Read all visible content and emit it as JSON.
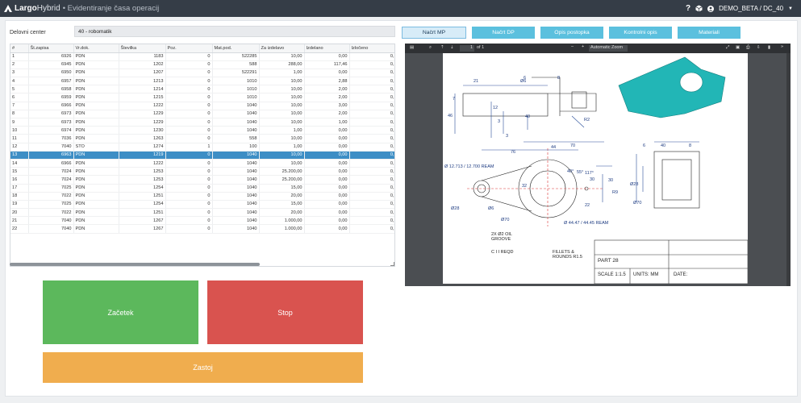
{
  "header": {
    "brand_bold": "Largo",
    "brand_light": "Hybrid",
    "subtitle": "• Evidentiranje časa operacij",
    "help_icon": "?",
    "user": "DEMO_BETA / DC_40"
  },
  "work_center": {
    "label": "Delovni center",
    "value": "40 - robomatik"
  },
  "grid": {
    "columns": [
      "#",
      "Št.zapisa",
      "Vr.dok.",
      "Številka",
      "Poz.",
      "Mat.pod.",
      "Za izdelavo",
      "Izdelano",
      "Izločeno"
    ],
    "rows": [
      [
        "1",
        "6926",
        "PDN",
        "1183",
        "0",
        "522285",
        "10,00",
        "0,00",
        "0,"
      ],
      [
        "2",
        "6945",
        "PDN",
        "1202",
        "0",
        "588",
        "288,00",
        "117,46",
        "0,"
      ],
      [
        "3",
        "6950",
        "PDN",
        "1207",
        "0",
        "522291",
        "1,00",
        "0,00",
        "0,"
      ],
      [
        "4",
        "6957",
        "PDN",
        "1213",
        "0",
        "1010",
        "10,00",
        "2,88",
        "0,"
      ],
      [
        "5",
        "6958",
        "PDN",
        "1214",
        "0",
        "1010",
        "10,00",
        "2,00",
        "0,"
      ],
      [
        "6",
        "6959",
        "PDN",
        "1215",
        "0",
        "1010",
        "10,00",
        "2,00",
        "0,"
      ],
      [
        "7",
        "6966",
        "PDN",
        "1222",
        "0",
        "1040",
        "10,00",
        "3,00",
        "0,"
      ],
      [
        "8",
        "6973",
        "PDN",
        "1229",
        "0",
        "1040",
        "10,00",
        "2,00",
        "0,"
      ],
      [
        "9",
        "6973",
        "PDN",
        "1229",
        "0",
        "1040",
        "10,00",
        "1,00",
        "0,"
      ],
      [
        "10",
        "6974",
        "PDN",
        "1230",
        "0",
        "1040",
        "1,00",
        "0,00",
        "0,"
      ],
      [
        "11",
        "7036",
        "PDN",
        "1263",
        "0",
        "558",
        "10,00",
        "0,00",
        "0,"
      ],
      [
        "12",
        "7040",
        "STO",
        "1274",
        "1",
        "100",
        "1,00",
        "0,00",
        "0,"
      ],
      [
        "13",
        "6963",
        "PDN",
        "1219",
        "0",
        "1040",
        "10,00",
        "0,00",
        "0,"
      ],
      [
        "14",
        "6966",
        "PDN",
        "1222",
        "0",
        "1040",
        "10,00",
        "0,00",
        "0,"
      ],
      [
        "15",
        "7024",
        "PDN",
        "1253",
        "0",
        "1040",
        "25.200,00",
        "0,00",
        "0,"
      ],
      [
        "16",
        "7024",
        "PDN",
        "1253",
        "0",
        "1040",
        "25.200,00",
        "0,00",
        "0,"
      ],
      [
        "17",
        "7025",
        "PDN",
        "1254",
        "0",
        "1040",
        "15,00",
        "0,00",
        "0,"
      ],
      [
        "18",
        "7022",
        "PDN",
        "1251",
        "0",
        "1040",
        "20,00",
        "0,00",
        "0,"
      ],
      [
        "19",
        "7025",
        "PDN",
        "1254",
        "0",
        "1040",
        "15,00",
        "0,00",
        "0,"
      ],
      [
        "20",
        "7022",
        "PDN",
        "1251",
        "0",
        "1040",
        "20,00",
        "0,00",
        "0,"
      ],
      [
        "21",
        "7040",
        "PDN",
        "1267",
        "0",
        "1040",
        "1.000,00",
        "0,00",
        "0,"
      ],
      [
        "22",
        "7040",
        "PDN",
        "1267",
        "0",
        "1040",
        "1.000,00",
        "0,00",
        "0,"
      ]
    ],
    "selected_row": 12
  },
  "actions": {
    "start": "Začetek",
    "stop": "Stop",
    "downtime": "Zastoj"
  },
  "tabs": [
    "Načrt MP",
    "Načrt DP",
    "Opis postopka",
    "Kontrolni opis",
    "Materiali"
  ],
  "viewer": {
    "page_current": "1",
    "page_total": "of 1",
    "zoom": "Automatic Zoom",
    "drawing": {
      "part": "PART 28",
      "scale": "SCALE 1:1.5",
      "units": "UNITS: MM",
      "date": "DATE:",
      "note_oil": "2X Ø2 OIL GROOVE",
      "note_fillets": "FILLETS & ROUNDS R1.5",
      "note_reqd": "C I I REQD",
      "dims": [
        "21",
        "7",
        "6",
        "8",
        "Ø6",
        "12",
        "46",
        "3",
        "40",
        "R2",
        "3",
        "76",
        "44",
        "70",
        "Ø 12.713 / 12.700 REAM",
        "40°",
        "55°",
        "117°",
        "32",
        "Ø28",
        "Ø6",
        "Ø70",
        "30",
        "22",
        "Ø 44.47 / 44.45 REAM",
        "40",
        "8",
        "Ø28",
        "Ø70",
        "6",
        "30",
        "R9"
      ]
    }
  },
  "colors": {
    "topbar": "#353d47",
    "start": "#5cb85c",
    "stop": "#d9534f",
    "downtime": "#f0ad4e",
    "tab": "#5bc0de",
    "selected_row": "#3d8ec5",
    "part_model": "#20b5b5"
  }
}
